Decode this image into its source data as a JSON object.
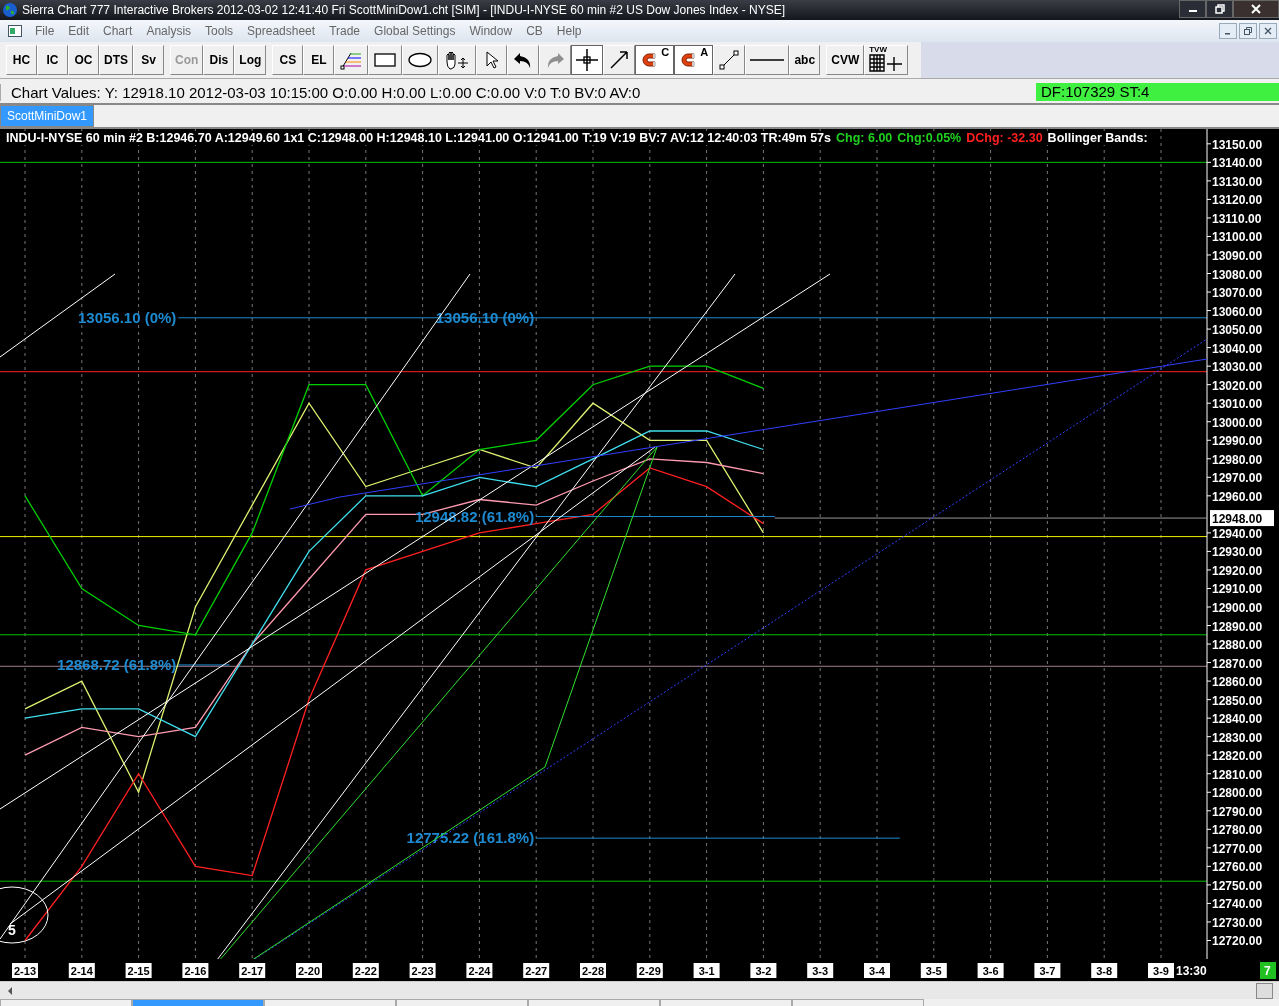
{
  "window": {
    "title": "Sierra Chart 777 Interactive Brokers 2012-03-02  12:41:40 Fri  ScottMiniDow1.cht [SIM] - [INDU-I-NYSE  60 min   #2  US Dow Jones Index - NYSE]"
  },
  "menu": [
    "File",
    "Edit",
    "Chart",
    "Analysis",
    "Tools",
    "Spreadsheet",
    "Trade",
    "Global Settings",
    "Window",
    "CB",
    "Help"
  ],
  "toolbar": [
    {
      "kind": "text",
      "label": "HC",
      "disabled": false,
      "pressed": false
    },
    {
      "kind": "text",
      "label": "IC",
      "disabled": false,
      "pressed": false
    },
    {
      "kind": "text",
      "label": "OC",
      "disabled": false,
      "pressed": false
    },
    {
      "kind": "text",
      "label": "DTS",
      "disabled": false,
      "pressed": false
    },
    {
      "kind": "text",
      "label": "Sv",
      "disabled": false,
      "pressed": false
    },
    {
      "kind": "gap"
    },
    {
      "kind": "text",
      "label": "Con",
      "disabled": true,
      "pressed": false
    },
    {
      "kind": "text",
      "label": "Dis",
      "disabled": false,
      "pressed": false
    },
    {
      "kind": "text",
      "label": "Log",
      "disabled": false,
      "pressed": false
    },
    {
      "kind": "gap"
    },
    {
      "kind": "text",
      "label": "CS",
      "disabled": false,
      "pressed": false
    },
    {
      "kind": "text",
      "label": "EL",
      "disabled": false,
      "pressed": false
    },
    {
      "kind": "icon",
      "disabled": false,
      "pressed": false
    },
    {
      "kind": "icon",
      "disabled": false,
      "pressed": false
    },
    {
      "kind": "icon",
      "disabled": false,
      "pressed": false
    },
    {
      "kind": "icon",
      "disabled": false,
      "pressed": false
    },
    {
      "kind": "icon",
      "disabled": false,
      "pressed": false
    },
    {
      "kind": "icon",
      "disabled": false,
      "pressed": false
    },
    {
      "kind": "icon",
      "disabled": true,
      "pressed": false
    },
    {
      "kind": "icon",
      "disabled": false,
      "pressed": true
    },
    {
      "kind": "icon",
      "disabled": false,
      "pressed": false
    },
    {
      "kind": "icon",
      "label": "C",
      "disabled": false,
      "pressed": true
    },
    {
      "kind": "icon",
      "label": "A",
      "disabled": false,
      "pressed": true
    },
    {
      "kind": "icon",
      "disabled": false,
      "pressed": false
    },
    {
      "kind": "icon",
      "disabled": false,
      "pressed": false
    },
    {
      "kind": "text",
      "label": "abc",
      "disabled": false,
      "pressed": false
    },
    {
      "kind": "gap"
    },
    {
      "kind": "text",
      "label": "CVW",
      "disabled": false,
      "pressed": false
    },
    {
      "kind": "icon",
      "label": "TVW",
      "disabled": false,
      "pressed": false
    }
  ],
  "chart_values": "Chart Values: Y: 12918.10  2012-03-03  10:15:00  O:0.00  H:0.00  L:0.00  C:0.00  V:0  T:0  BV:0  AV:0",
  "status": "DF:107329  ST:4",
  "chart_tabs": [
    {
      "label": "ScottMiniDow1",
      "selected": true
    }
  ],
  "header": [
    {
      "text": "INDU-I-NYSE  60 min   #2 B:12946.70 A:12949.60 1x1 C:12948.00 H:12948.10 L:12941.00 O:12941.00 T:19 V:19 BV:7 AV:12 12:40:03 TR:49m 57s",
      "color": "#ffffff"
    },
    {
      "text": "Chg: 6.00",
      "color": "#20d020"
    },
    {
      "text": "Chg:0.05%",
      "color": "#20d020"
    },
    {
      "text": "DChg: -32.30",
      "color": "#ff2020"
    },
    {
      "text": "Bollinger Bands:",
      "color": "#ffffff"
    }
  ],
  "chart_data": {
    "type": "line",
    "categories": [
      "2-13",
      "2-14",
      "2-15",
      "2-16",
      "2-17",
      "2-20",
      "2-22",
      "2-23",
      "2-24",
      "2-27",
      "2-28",
      "2-29",
      "3-1",
      "3-2",
      "3-3",
      "3-4",
      "3-5",
      "3-6",
      "3-7",
      "3-8",
      "3-9"
    ],
    "series": [
      {
        "color": "#e0f070",
        "values": [
          12845,
          12860,
          12800,
          12900,
          12955,
          13010,
          12965,
          12975,
          12985,
          12975,
          13010,
          12990,
          12990,
          12940,
          null,
          null,
          null,
          null,
          null,
          null,
          null
        ]
      },
      {
        "color": "#00d000",
        "values": [
          12960,
          12910,
          12890,
          12885,
          12940,
          13020,
          13020,
          12960,
          12985,
          12990,
          13020,
          13030,
          13030,
          13018,
          null,
          null,
          null,
          null,
          null,
          null,
          null
        ]
      },
      {
        "color": "#ff9ab0",
        "values": [
          12820,
          12835,
          12830,
          12835,
          12880,
          12915,
          12950,
          12950,
          12958,
          12955,
          12968,
          12980,
          12978,
          12972,
          null,
          null,
          null,
          null,
          null,
          null,
          null
        ]
      },
      {
        "color": "#40e0f0",
        "values": [
          12840,
          12845,
          12845,
          12830,
          12880,
          12930,
          12960,
          12960,
          12970,
          12965,
          12980,
          12995,
          12995,
          12985,
          null,
          null,
          null,
          null,
          null,
          null,
          null
        ]
      },
      {
        "color": "#ff2020",
        "values": [
          12720,
          12760,
          12810,
          12760,
          12755,
          12850,
          12920,
          12930,
          12940,
          12945,
          12950,
          12975,
          12965,
          12945,
          null,
          null,
          null,
          null,
          null,
          null,
          null
        ]
      }
    ],
    "ylim": [
      12710,
      13158
    ],
    "grid": true,
    "yticks": [
      {
        "value": 13150,
        "label": "13150.00"
      },
      {
        "value": 13140,
        "label": "13140.00"
      },
      {
        "value": 13130,
        "label": "13130.00"
      },
      {
        "value": 13120,
        "label": "13120.00"
      },
      {
        "value": 13110,
        "label": "13110.00"
      },
      {
        "value": 13100,
        "label": "13100.00"
      },
      {
        "value": 13090,
        "label": "13090.00"
      },
      {
        "value": 13080,
        "label": "13080.00"
      },
      {
        "value": 13070,
        "label": "13070.00"
      },
      {
        "value": 13060,
        "label": "13060.00"
      },
      {
        "value": 13050,
        "label": "13050.00"
      },
      {
        "value": 13040,
        "label": "13040.00"
      },
      {
        "value": 13030,
        "label": "13030.00"
      },
      {
        "value": 13020,
        "label": "13020.00"
      },
      {
        "value": 13010,
        "label": "13010.00"
      },
      {
        "value": 13000,
        "label": "13000.00"
      },
      {
        "value": 12990,
        "label": "12990.00"
      },
      {
        "value": 12980,
        "label": "12980.00"
      },
      {
        "value": 12970,
        "label": "12970.00"
      },
      {
        "value": 12960,
        "label": "12960.00"
      },
      {
        "value": 12940,
        "label": "12940.00"
      },
      {
        "value": 12930,
        "label": "12930.00"
      },
      {
        "value": 12920,
        "label": "12920.00"
      },
      {
        "value": 12910,
        "label": "12910.00"
      },
      {
        "value": 12900,
        "label": "12900.00"
      },
      {
        "value": 12890,
        "label": "12890.00"
      },
      {
        "value": 12880,
        "label": "12880.00"
      },
      {
        "value": 12870,
        "label": "12870.00"
      },
      {
        "value": 12860,
        "label": "12860.00"
      },
      {
        "value": 12850,
        "label": "12850.00"
      },
      {
        "value": 12840,
        "label": "12840.00"
      },
      {
        "value": 12830,
        "label": "12830.00"
      },
      {
        "value": 12820,
        "label": "12820.00"
      },
      {
        "value": 12810,
        "label": "12810.00"
      },
      {
        "value": 12800,
        "label": "12800.00"
      },
      {
        "value": 12790,
        "label": "12790.00"
      },
      {
        "value": 12780,
        "label": "12780.00"
      },
      {
        "value": 12770,
        "label": "12770.00"
      },
      {
        "value": 12760,
        "label": "12760.00"
      },
      {
        "value": 12750,
        "label": "12750.00"
      },
      {
        "value": 12740,
        "label": "12740.00"
      },
      {
        "value": 12730,
        "label": "12730.00"
      },
      {
        "value": 12720,
        "label": "12720.00"
      }
    ],
    "ref_lines": [
      {
        "axis": "y",
        "value": 13140,
        "color": "#00c000"
      },
      {
        "axis": "y",
        "value": 13027,
        "color": "#ff2020"
      },
      {
        "axis": "y",
        "value": 12885,
        "color": "#00c000"
      },
      {
        "axis": "y",
        "value": 12938,
        "color": "#f0f000"
      },
      {
        "axis": "y",
        "value": 12868,
        "color": "#a08090"
      },
      {
        "axis": "y",
        "value": 12752,
        "color": "#00c000"
      },
      {
        "axis": "y",
        "value": 13056.1,
        "label": "13056.10 (0%)",
        "color": "#1e8ad0"
      },
      {
        "axis": "y",
        "value": 12948.82,
        "label": "12948.82 (61.8%)",
        "color": "#1e8ad0"
      },
      {
        "axis": "y",
        "value": 12868.72,
        "label": "12868.72 (61.8%)",
        "color": "#1e8ad0"
      },
      {
        "axis": "y",
        "value": 12775.22,
        "label": "12775.22 (161.8%)",
        "color": "#1e8ad0"
      },
      {
        "axis": "y",
        "value": 12948,
        "label": "12948.00"
      }
    ],
    "annotations": [
      {
        "text": "13056.10 (0%)",
        "x": "2-27",
        "y": 13056.1
      }
    ]
  },
  "time_label": "13:30",
  "region_number": "5",
  "corner_badge": "7",
  "bottom_tabs": [
    {
      "selected": false
    },
    {
      "selected": true
    },
    {
      "selected": false
    },
    {
      "selected": false
    },
    {
      "selected": false
    },
    {
      "selected": false
    },
    {
      "selected": false
    }
  ]
}
